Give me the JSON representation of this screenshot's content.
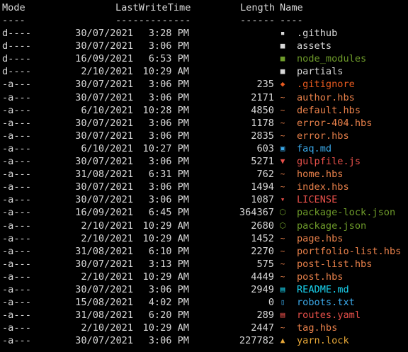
{
  "headers": {
    "mode": "Mode",
    "last_write_time": "LastWriteTime",
    "length": "Length",
    "name": "Name"
  },
  "underlines": {
    "mode": "----",
    "last_write_time": "-------------",
    "length": "------",
    "name": "----"
  },
  "colors": {
    "background": "#000000",
    "default_text": "#d8d8d8"
  },
  "rows": [
    {
      "mode": "d----",
      "date": "30/07/2021",
      "time": "3:28 PM",
      "length": "",
      "name": ".github",
      "icon": "github-folder-icon",
      "glyph": "▪",
      "color": "#d8d8d8",
      "icon_color": "#d8d8d8"
    },
    {
      "mode": "d----",
      "date": "30/07/2021",
      "time": "3:06 PM",
      "length": "",
      "name": "assets",
      "icon": "folder-icon",
      "glyph": "■",
      "color": "#d8d8d8",
      "icon_color": "#d8d8d8"
    },
    {
      "mode": "d----",
      "date": "16/09/2021",
      "time": "6:53 PM",
      "length": "",
      "name": "node_modules",
      "icon": "node-folder-icon",
      "glyph": "■",
      "color": "#6e9b2a",
      "icon_color": "#6e9b2a"
    },
    {
      "mode": "d----",
      "date": "2/10/2021",
      "time": "10:29 AM",
      "length": "",
      "name": "partials",
      "icon": "folder-icon",
      "glyph": "■",
      "color": "#d8d8d8",
      "icon_color": "#d8d8d8"
    },
    {
      "mode": "-a---",
      "date": "30/07/2021",
      "time": "3:06 PM",
      "length": "235",
      "name": ".gitignore",
      "icon": "git-icon",
      "glyph": "◆",
      "color": "#e85a1f",
      "icon_color": "#e85a1f"
    },
    {
      "mode": "-a---",
      "date": "30/07/2021",
      "time": "3:06 PM",
      "length": "2171",
      "name": "author.hbs",
      "icon": "handlebars-icon",
      "glyph": "~",
      "color": "#e8804a",
      "icon_color": "#e8804a"
    },
    {
      "mode": "-a---",
      "date": "6/10/2021",
      "time": "10:28 PM",
      "length": "4850",
      "name": "default.hbs",
      "icon": "handlebars-icon",
      "glyph": "~",
      "color": "#e8804a",
      "icon_color": "#e8804a"
    },
    {
      "mode": "-a---",
      "date": "30/07/2021",
      "time": "3:06 PM",
      "length": "1178",
      "name": "error-404.hbs",
      "icon": "handlebars-icon",
      "glyph": "~",
      "color": "#e8804a",
      "icon_color": "#e8804a"
    },
    {
      "mode": "-a---",
      "date": "30/07/2021",
      "time": "3:06 PM",
      "length": "2835",
      "name": "error.hbs",
      "icon": "handlebars-icon",
      "glyph": "~",
      "color": "#e8804a",
      "icon_color": "#e8804a"
    },
    {
      "mode": "-a---",
      "date": "6/10/2021",
      "time": "10:27 PM",
      "length": "603",
      "name": "faq.md",
      "icon": "markdown-icon",
      "glyph": "▣",
      "color": "#3aa8e8",
      "icon_color": "#3aa8e8"
    },
    {
      "mode": "-a---",
      "date": "30/07/2021",
      "time": "3:06 PM",
      "length": "5271",
      "name": "gulpfile.js",
      "icon": "gulp-icon",
      "glyph": "▼",
      "color": "#e8504a",
      "icon_color": "#e8504a"
    },
    {
      "mode": "-a---",
      "date": "31/08/2021",
      "time": "6:31 PM",
      "length": "762",
      "name": "home.hbs",
      "icon": "handlebars-icon",
      "glyph": "~",
      "color": "#e8804a",
      "icon_color": "#e8804a"
    },
    {
      "mode": "-a---",
      "date": "30/07/2021",
      "time": "3:06 PM",
      "length": "1494",
      "name": "index.hbs",
      "icon": "handlebars-icon",
      "glyph": "~",
      "color": "#e8804a",
      "icon_color": "#e8804a"
    },
    {
      "mode": "-a---",
      "date": "30/07/2021",
      "time": "3:06 PM",
      "length": "1087",
      "name": "LICENSE",
      "icon": "license-icon",
      "glyph": "▾",
      "color": "#e8504a",
      "icon_color": "#e8504a"
    },
    {
      "mode": "-a---",
      "date": "16/09/2021",
      "time": "6:45 PM",
      "length": "364367",
      "name": "package-lock.json",
      "icon": "npm-package-icon",
      "glyph": "⬡",
      "color": "#6e9b2a",
      "icon_color": "#6e9b2a"
    },
    {
      "mode": "-a---",
      "date": "2/10/2021",
      "time": "10:29 AM",
      "length": "2680",
      "name": "package.json",
      "icon": "npm-package-icon",
      "glyph": "⬡",
      "color": "#6e9b2a",
      "icon_color": "#6e9b2a"
    },
    {
      "mode": "-a---",
      "date": "2/10/2021",
      "time": "10:29 AM",
      "length": "1452",
      "name": "page.hbs",
      "icon": "handlebars-icon",
      "glyph": "~",
      "color": "#e8804a",
      "icon_color": "#e8804a"
    },
    {
      "mode": "-a---",
      "date": "31/08/2021",
      "time": "6:10 PM",
      "length": "2270",
      "name": "portfolio-list.hbs",
      "icon": "handlebars-icon",
      "glyph": "~",
      "color": "#e8804a",
      "icon_color": "#e8804a"
    },
    {
      "mode": "-a---",
      "date": "30/07/2021",
      "time": "3:13 PM",
      "length": "575",
      "name": "post-list.hbs",
      "icon": "handlebars-icon",
      "glyph": "~",
      "color": "#e8804a",
      "icon_color": "#e8804a"
    },
    {
      "mode": "-a---",
      "date": "2/10/2021",
      "time": "10:29 AM",
      "length": "4449",
      "name": "post.hbs",
      "icon": "handlebars-icon",
      "glyph": "~",
      "color": "#e8804a",
      "icon_color": "#e8804a"
    },
    {
      "mode": "-a---",
      "date": "30/07/2021",
      "time": "3:06 PM",
      "length": "2949",
      "name": "README.md",
      "icon": "readme-icon",
      "glyph": "▤",
      "color": "#19d4f0",
      "icon_color": "#19d4f0"
    },
    {
      "mode": "-a---",
      "date": "15/08/2021",
      "time": "4:02 PM",
      "length": "0",
      "name": "robots.txt",
      "icon": "text-file-icon",
      "glyph": "▯",
      "color": "#3aa8e8",
      "icon_color": "#3aa8e8"
    },
    {
      "mode": "-a---",
      "date": "31/08/2021",
      "time": "6:20 PM",
      "length": "289",
      "name": "routes.yaml",
      "icon": "yaml-icon",
      "glyph": "▤",
      "color": "#e8504a",
      "icon_color": "#e8504a"
    },
    {
      "mode": "-a---",
      "date": "2/10/2021",
      "time": "10:29 AM",
      "length": "2447",
      "name": "tag.hbs",
      "icon": "handlebars-icon",
      "glyph": "~",
      "color": "#e8804a",
      "icon_color": "#e8804a"
    },
    {
      "mode": "-a---",
      "date": "30/07/2021",
      "time": "3:06 PM",
      "length": "227782",
      "name": "yarn.lock",
      "icon": "lock-icon",
      "glyph": "▲",
      "color": "#e8a838",
      "icon_color": "#e8a838"
    }
  ]
}
